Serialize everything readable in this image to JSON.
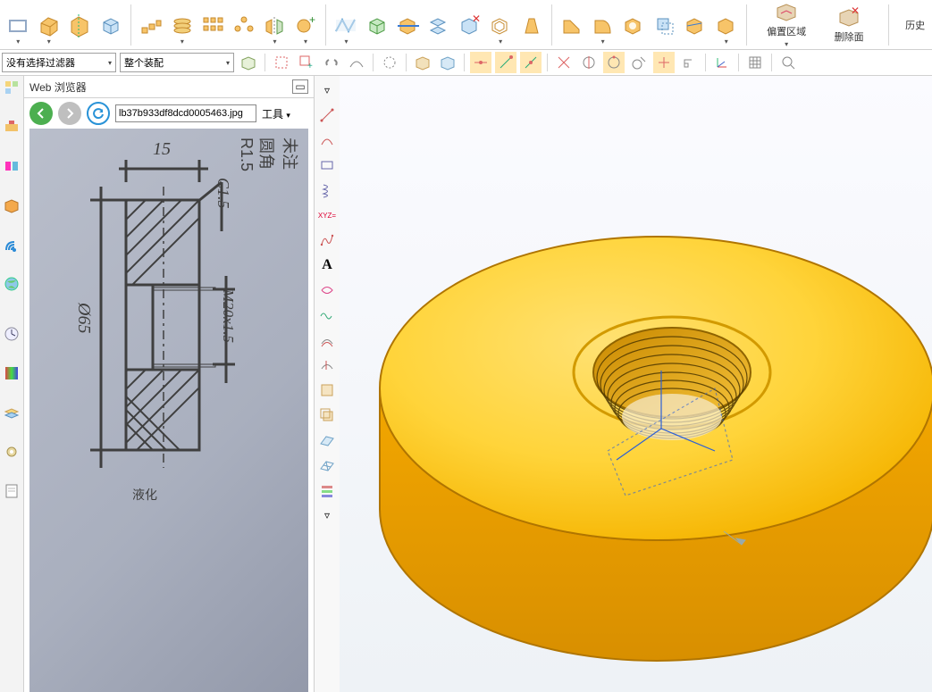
{
  "ribbon_right": {
    "offset_label": "偏置区域",
    "delete_label": "删除面",
    "history_label": "历史"
  },
  "secondbar": {
    "filter_combo": "没有选择过滤器",
    "assembly_combo": "整个装配"
  },
  "webpanel": {
    "title": "Web 浏览器",
    "url_value": "lb37b933df8dcd0005463.jpg",
    "tools_label": "工具",
    "min_glyph": "▭"
  },
  "blueprint": {
    "note": "未注圆角 R1.5",
    "dim_top": "15",
    "dim_c": "C1.5",
    "dim_thread": "M20x1.5",
    "dim_dia": "Ø65",
    "footer": "液化"
  }
}
